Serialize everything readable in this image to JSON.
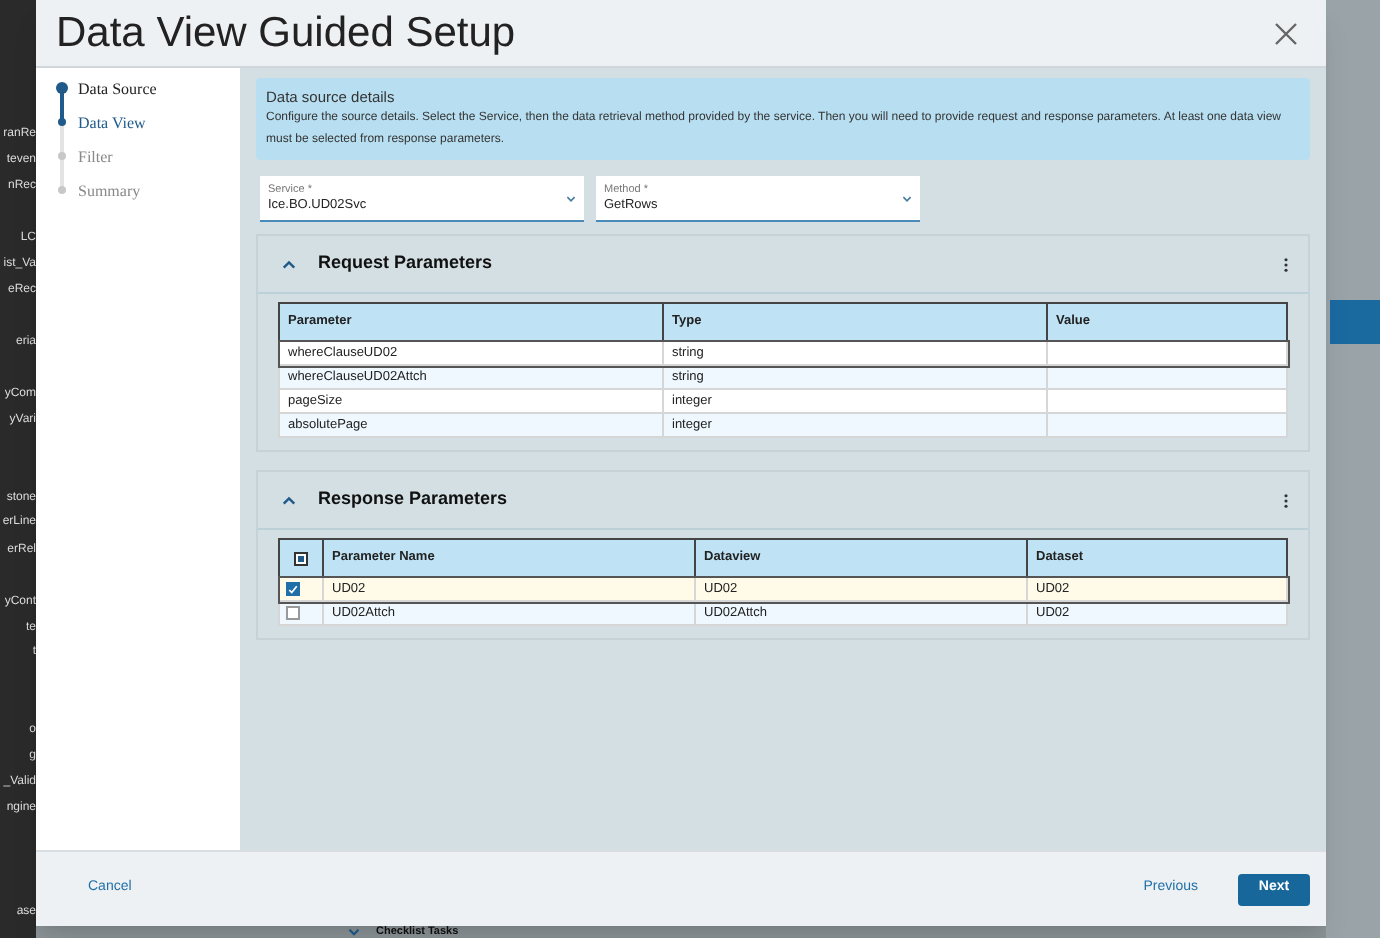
{
  "background": {
    "sidebar_items": [
      "ranRe",
      "teven",
      "nRec",
      "LC",
      "ist_Va",
      "eRec",
      "eria",
      "yCom",
      "yVari",
      "stone",
      "erLine",
      "erRel",
      "yCont",
      "te",
      "t",
      "o",
      "g",
      "_Valid",
      "ngine",
      "ase"
    ],
    "section_title": "Checklist Tasks"
  },
  "dialog": {
    "title": "Data View Guided Setup",
    "steps": [
      {
        "label": "Data Source",
        "completed": true,
        "selected": false
      },
      {
        "label": "Data View",
        "completed": false,
        "selected": true
      },
      {
        "label": "Filter",
        "completed": false,
        "selected": false
      },
      {
        "label": "Summary",
        "completed": false,
        "selected": false
      }
    ],
    "info": {
      "title": "Data source details",
      "text": "Configure the source details. Select the Service, then the data retrieval method provided by the service. Then you will need to provide request and response parameters. At least one data view must be selected from response parameters."
    },
    "fields": [
      {
        "label": "Service *",
        "value": "Ice.BO.UD02Svc"
      },
      {
        "label": "Method *",
        "value": "GetRows"
      }
    ],
    "request": {
      "title": "Request Parameters",
      "expanded": true,
      "columns": [
        "Parameter",
        "Type",
        "Value"
      ],
      "rows": [
        {
          "cells": [
            "whereClauseUD02",
            "string",
            null
          ],
          "selected": true
        },
        {
          "cells": [
            "whereClauseUD02Attch",
            "string",
            null
          ],
          "selected": false
        },
        {
          "cells": [
            "pageSize",
            "integer",
            null
          ],
          "selected": false
        },
        {
          "cells": [
            "absolutePage",
            "integer",
            null
          ],
          "selected": false
        }
      ]
    },
    "response": {
      "title": "Response Parameters",
      "expanded": true,
      "select_all_indeterminate": true,
      "columns": [
        "Parameter Name",
        "Dataview",
        "Dataset"
      ],
      "rows": [
        {
          "cells": [
            "UD02",
            "UD02",
            "UD02"
          ],
          "checked": true,
          "selected": true
        },
        {
          "cells": [
            "UD02Attch",
            "UD02Attch",
            "UD02"
          ],
          "checked": false,
          "selected": false
        }
      ]
    },
    "buttons": {
      "cancel": "Cancel",
      "previous": "Previous",
      "next": "Next"
    }
  }
}
